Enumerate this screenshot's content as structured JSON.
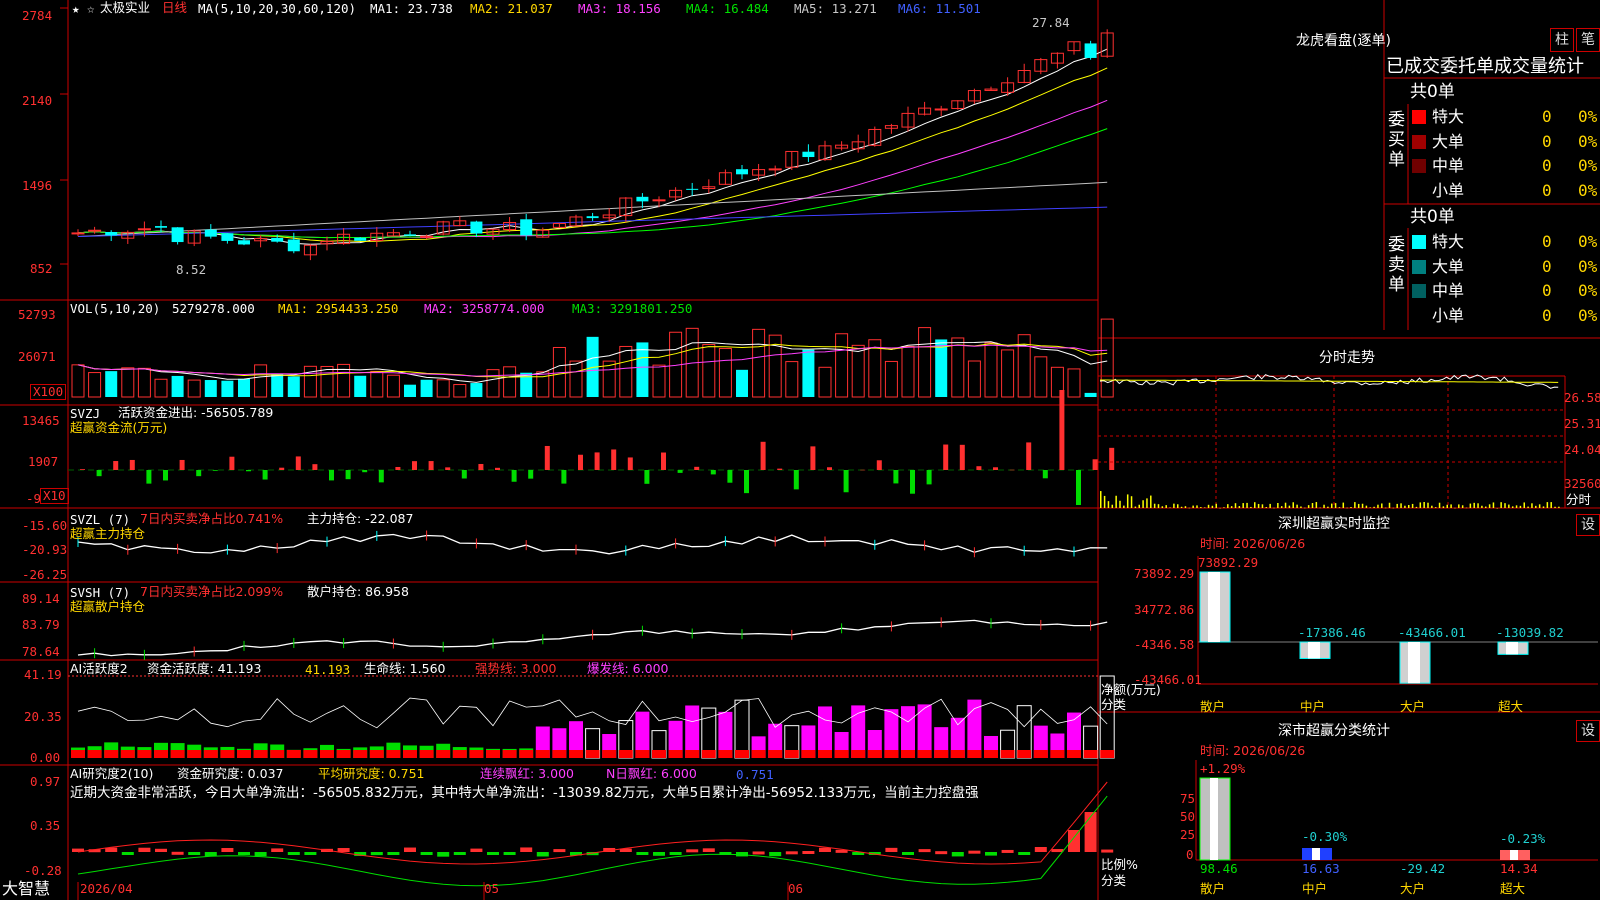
{
  "app": {
    "title": "大智慧",
    "date_axis": [
      "2026/04",
      "05",
      "06"
    ]
  },
  "stock": {
    "name": "太极实业",
    "period": "日线",
    "high_mark": "27.84",
    "low_mark": "8.52"
  },
  "main_legend": {
    "params": "MA(5,10,20,30,60,120)",
    "ma1": "MA1: 23.738",
    "ma2": "MA2: 21.037",
    "ma3": "MA3: 18.156",
    "ma4": "MA4: 16.484",
    "ma5": "MA5: 13.271",
    "ma6": "MA6: 11.501"
  },
  "main_axis": [
    "2784",
    "2140",
    "1496",
    "852"
  ],
  "vol": {
    "params": "VOL(5,10,20)",
    "value": "5279278.000",
    "ma1": "MA1: 2954433.250",
    "ma2": "MA2: 3258774.000",
    "ma3": "MA3: 3291801.250",
    "axis": [
      "52793",
      "26071"
    ],
    "unit": "X100"
  },
  "svzj": {
    "label": "SVZJ",
    "desc": "活跃资金进出: -56505.789",
    "sub": "超赢资金流(万元)",
    "axis": [
      "13465",
      "1907",
      "-9"
    ],
    "unit": "X10"
  },
  "svzl": {
    "label": "SVZL (7)",
    "ratio": "7日内买卖净占比0.741%",
    "hold": "主力持仓: -22.087",
    "sub": "超赢主力持仓",
    "axis": [
      "-15.60",
      "-20.93",
      "-26.25"
    ]
  },
  "svsh": {
    "label": "SVSH (7)",
    "ratio": "7日内买卖净占比2.099%",
    "hold": "散户持仓: 86.958",
    "sub": "超赢散户持仓",
    "axis": [
      "89.14",
      "83.79",
      "78.64"
    ]
  },
  "ai1": {
    "label": "AI活跃度2",
    "a": "资金活跃度: 41.193",
    "b": "41.193",
    "c": "生命线: 1.560",
    "d": "强势线: 3.000",
    "e": "爆发线: 6.000",
    "axis": [
      "41.19",
      "20.35",
      "0.00"
    ]
  },
  "ai2": {
    "label": "AI研究度2(10)",
    "a": "资金研究度: 0.037",
    "b": "平均研究度: 0.751",
    "c": "连续飘红: 3.000",
    "d": "N日飘红: 6.000",
    "e": "0.751",
    "comment": "近期大资金非常活跃，今日大单净流出：-56505.832万元，其中特大单净流出：-13039.82万元，大单5日累计净出-56952.133万元，当前主力控盘强",
    "axis": [
      "0.97",
      "0.35",
      "-0.28"
    ]
  },
  "lhb": {
    "title": "龙虎看盘(逐单)",
    "btn1": "柱",
    "btn2": "笔",
    "tabs": "已成交委托单成交量统计",
    "buy": {
      "total": "共0单",
      "side": "委买单",
      "rows": [
        {
          "name": "特大",
          "n": "0",
          "p": "0%",
          "color": "#ff0000"
        },
        {
          "name": "大单",
          "n": "0",
          "p": "0%",
          "color": "#a00000"
        },
        {
          "name": "中单",
          "n": "0",
          "p": "0%",
          "color": "#700000"
        },
        {
          "name": "小单",
          "n": "0",
          "p": "0%",
          "color": ""
        }
      ]
    },
    "sell": {
      "total": "共0单",
      "side": "委卖单",
      "rows": [
        {
          "name": "特大",
          "n": "0",
          "p": "0%",
          "color": "#00ffff"
        },
        {
          "name": "大单",
          "n": "0",
          "p": "0%",
          "color": "#008080"
        },
        {
          "name": "中单",
          "n": "0",
          "p": "0%",
          "color": "#006060"
        },
        {
          "name": "小单",
          "n": "0",
          "p": "0%",
          "color": ""
        }
      ]
    }
  },
  "intraday": {
    "title": "分时走势",
    "axis": [
      "26.58",
      "25.31",
      "24.04",
      "32560"
    ],
    "label": "分时"
  },
  "monitor": {
    "title": "深圳超赢实时监控",
    "btn": "设",
    "time": "时间: 2026/06/26",
    "axis": [
      "73892.29",
      "34772.86",
      "-4346.58",
      "-43466.01"
    ],
    "ylabel": "净额(万元)",
    "xlabel": "分类",
    "bars": [
      {
        "cat": "散户",
        "value": 73892.29,
        "label": "73892.29"
      },
      {
        "cat": "中户",
        "value": -17386.46,
        "label": "-17386.46"
      },
      {
        "cat": "大户",
        "value": -43466.01,
        "label": "-43466.01"
      },
      {
        "cat": "超大",
        "value": -13039.82,
        "label": "-13039.82"
      }
    ]
  },
  "classify": {
    "title": "深市超赢分类统计",
    "btn": "设",
    "time": "时间: 2026/06/26",
    "axis": [
      "75",
      "50",
      "25",
      "0"
    ],
    "ylabel": "比例%",
    "xlabel": "分类",
    "bars": [
      {
        "cat": "散户",
        "pct": "+1.29%",
        "value": "98.46"
      },
      {
        "cat": "中户",
        "pct": "-0.30%",
        "value": "16.63"
      },
      {
        "cat": "大户",
        "pct": "",
        "value": "-29.42"
      },
      {
        "cat": "超大",
        "pct": "-0.23%",
        "value": "14.34"
      }
    ]
  },
  "colors": {
    "up": "#ff3030",
    "down": "#00ffff",
    "frame": "#cc0000",
    "ma1": "#ffffff",
    "ma2": "#ffff00",
    "ma3": "#ff40ff",
    "ma4": "#00ff00",
    "ma5": "#c0c0c0",
    "ma6": "#4040ff"
  }
}
